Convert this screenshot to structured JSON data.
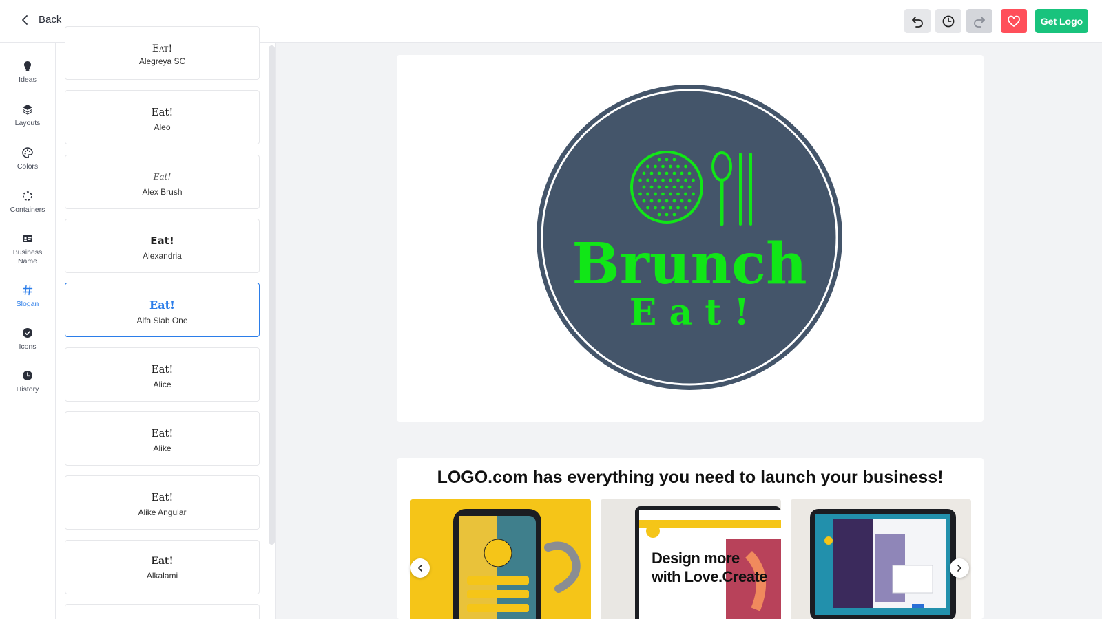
{
  "topbar": {
    "back_label": "Back",
    "get_logo_label": "Get Logo",
    "icons": [
      "undo-icon",
      "history-icon",
      "redo-icon",
      "heart-icon"
    ]
  },
  "rail": {
    "items": [
      {
        "label": "Ideas",
        "icon": "lightbulb-icon"
      },
      {
        "label": "Layouts",
        "icon": "layers-icon"
      },
      {
        "label": "Colors",
        "icon": "palette-icon"
      },
      {
        "label": "Containers",
        "icon": "container-icon"
      },
      {
        "label": "Business Name",
        "icon": "id-card-icon"
      },
      {
        "label": "Slogan",
        "icon": "hashtag-icon"
      },
      {
        "label": "Icons",
        "icon": "check-circle-icon"
      },
      {
        "label": "History",
        "icon": "clock-icon"
      }
    ],
    "active": "Slogan"
  },
  "fonts": {
    "sample_text": "Eat!",
    "items": [
      {
        "name": "Alegreya SC"
      },
      {
        "name": "Aleo"
      },
      {
        "name": "Alex Brush"
      },
      {
        "name": "Alexandria"
      },
      {
        "name": "Alfa Slab One"
      },
      {
        "name": "Alice"
      },
      {
        "name": "Alike"
      },
      {
        "name": "Alike Angular"
      },
      {
        "name": "Alkalami"
      }
    ],
    "selected": "Alfa Slab One"
  },
  "logo": {
    "business_name": "Brunch",
    "slogan": "E a t !",
    "colors": {
      "background": "#44556a",
      "accent": "#11e617",
      "ring": "#ffffff"
    }
  },
  "promo": {
    "title": "LOGO.com has everything you need to launch your business!",
    "slide2_heading_line1": "Design more",
    "slide2_heading_line2": "with Love.Create"
  },
  "colors": {
    "brand_green": "#19c37d",
    "selected_blue": "#2b7de9",
    "favorite_red": "#ff4f5a"
  }
}
